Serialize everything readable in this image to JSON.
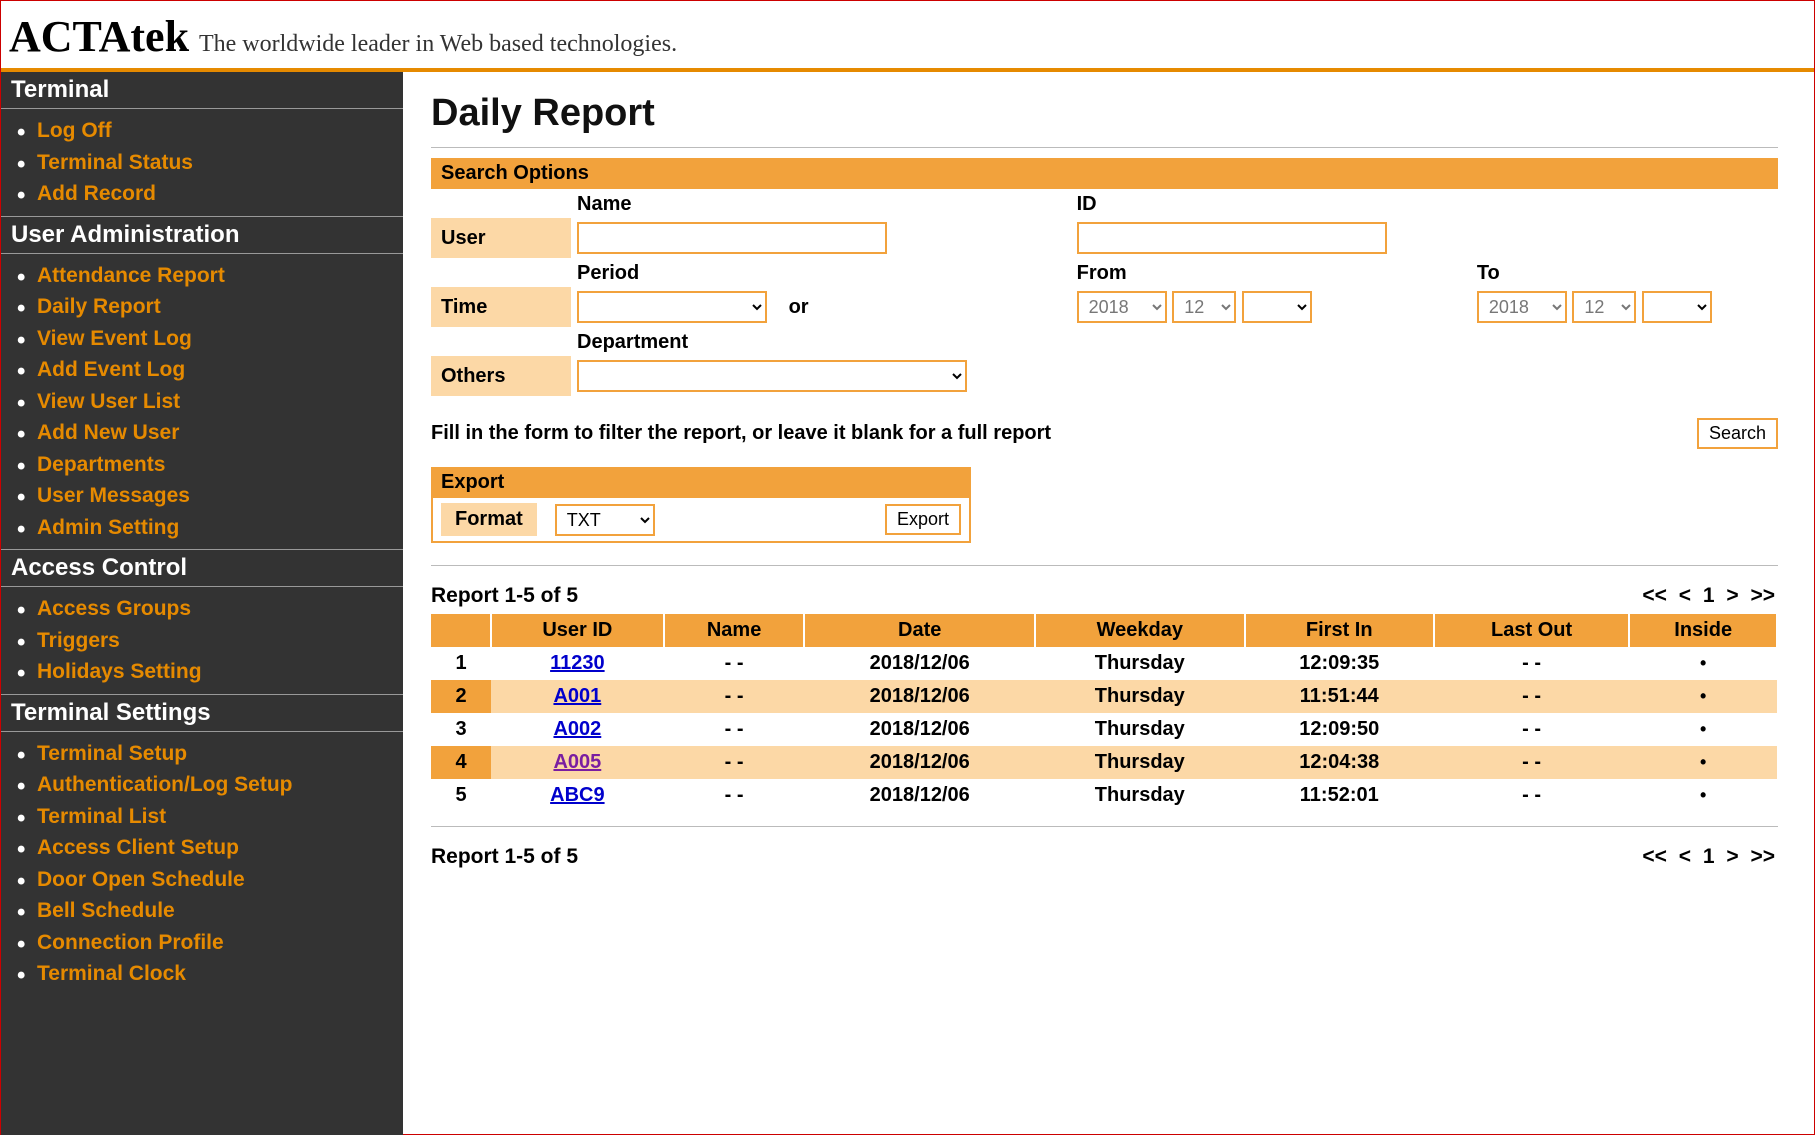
{
  "header": {
    "brand": "ACTAtek",
    "tagline": "The worldwide leader in Web based technologies."
  },
  "sidebar": {
    "sections": [
      {
        "title": "Terminal",
        "items": [
          "Log Off",
          "Terminal Status",
          "Add Record"
        ]
      },
      {
        "title": "User Administration",
        "items": [
          "Attendance Report",
          "Daily Report",
          "View Event Log",
          "Add Event Log",
          "View User List",
          "Add New User",
          "Departments",
          "User Messages",
          "Admin Setting"
        ]
      },
      {
        "title": "Access Control",
        "items": [
          "Access Groups",
          "Triggers",
          "Holidays Setting"
        ]
      },
      {
        "title": "Terminal Settings",
        "items": [
          "Terminal Setup",
          "Authentication/Log Setup",
          "Terminal List",
          "Access Client Setup",
          "Door Open Schedule",
          "Bell Schedule",
          "Connection Profile",
          "Terminal Clock"
        ]
      }
    ]
  },
  "main": {
    "title": "Daily Report",
    "search_options_label": "Search Options",
    "labels": {
      "user": "User",
      "name": "Name",
      "id": "ID",
      "time": "Time",
      "period": "Period",
      "or": "or",
      "from": "From",
      "to": "To",
      "others": "Others",
      "department": "Department"
    },
    "from": {
      "year": "2018",
      "month": "12",
      "day": ""
    },
    "to": {
      "year": "2018",
      "month": "12",
      "day": ""
    },
    "instruction": "Fill in the form to filter the report, or leave it blank for a full report",
    "search_button": "Search",
    "export": {
      "header": "Export",
      "format_label": "Format",
      "format_value": "TXT",
      "button": "Export"
    },
    "report": {
      "summary": "Report 1-5 of 5",
      "pager": {
        "first": "<<",
        "prev": "<",
        "page": "1",
        "next": ">",
        "last": ">>"
      },
      "headers": [
        "",
        "User ID",
        "Name",
        "Date",
        "Weekday",
        "First In",
        "Last Out",
        "Inside"
      ],
      "rows": [
        {
          "n": "1",
          "uid": "11230",
          "name": "- -",
          "date": "2018/12/06",
          "weekday": "Thursday",
          "first_in": "12:09:35",
          "last_out": "- -",
          "inside": "•",
          "visited": false
        },
        {
          "n": "2",
          "uid": "A001",
          "name": "- -",
          "date": "2018/12/06",
          "weekday": "Thursday",
          "first_in": "11:51:44",
          "last_out": "- -",
          "inside": "•",
          "visited": false
        },
        {
          "n": "3",
          "uid": "A002",
          "name": "- -",
          "date": "2018/12/06",
          "weekday": "Thursday",
          "first_in": "12:09:50",
          "last_out": "- -",
          "inside": "•",
          "visited": false
        },
        {
          "n": "4",
          "uid": "A005",
          "name": "- -",
          "date": "2018/12/06",
          "weekday": "Thursday",
          "first_in": "12:04:38",
          "last_out": "- -",
          "inside": "•",
          "visited": true
        },
        {
          "n": "5",
          "uid": "ABC9",
          "name": "- -",
          "date": "2018/12/06",
          "weekday": "Thursday",
          "first_in": "11:52:01",
          "last_out": "- -",
          "inside": "•",
          "visited": false
        }
      ]
    }
  }
}
